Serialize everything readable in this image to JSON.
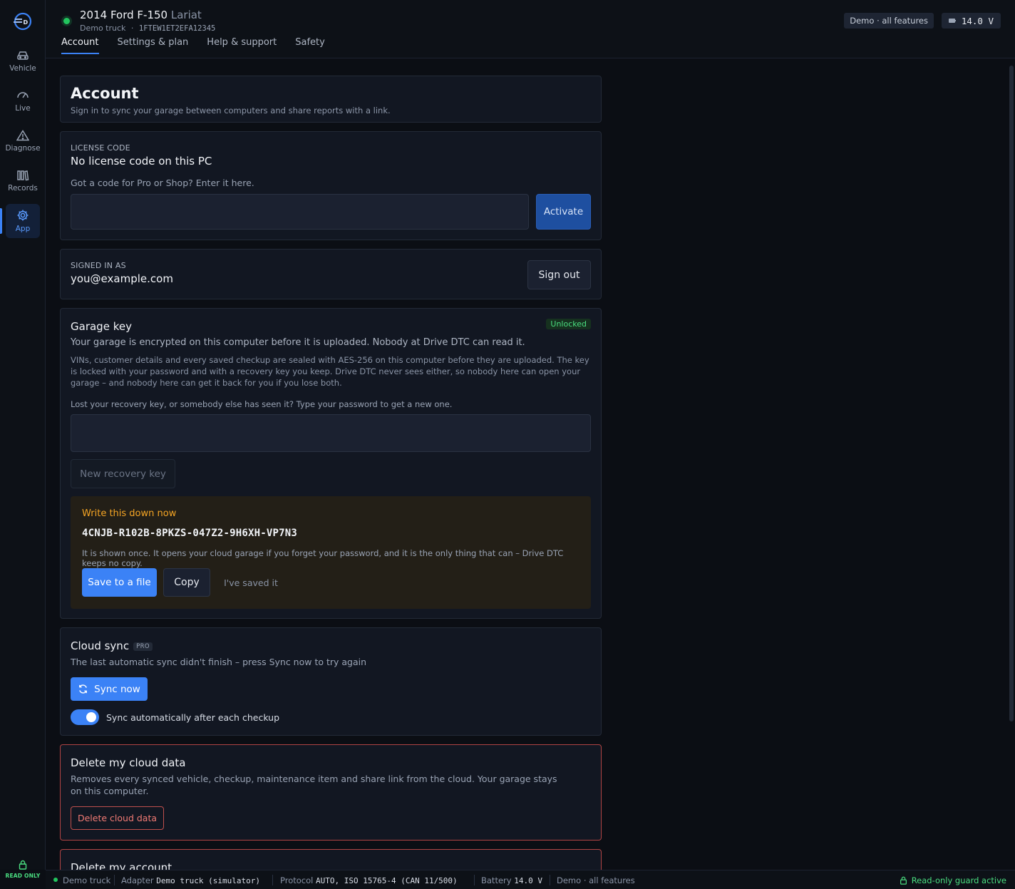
{
  "header": {
    "vehicle_title": "2014 Ford F-150",
    "vehicle_trim": "Lariat",
    "vehicle_label": "Demo truck",
    "separator": "·",
    "vin": "1FTEW1ET2EFA12345",
    "demo_badge": "Demo · all features",
    "voltage": "14.0 V",
    "tabs": [
      {
        "label": "Account",
        "active": true
      },
      {
        "label": "Settings & plan"
      },
      {
        "label": "Help & support"
      },
      {
        "label": "Safety"
      }
    ]
  },
  "sidebar": {
    "items": [
      {
        "label": "Vehicle",
        "icon": "car-icon"
      },
      {
        "label": "Live",
        "icon": "gauge-icon"
      },
      {
        "label": "Diagnose",
        "icon": "warning-icon"
      },
      {
        "label": "Records",
        "icon": "books-icon"
      },
      {
        "label": "App",
        "icon": "gear-icon",
        "active": true
      }
    ],
    "read_only_label": "READ ONLY"
  },
  "account": {
    "title": "Account",
    "subtitle": "Sign in to sync your garage between computers and share reports with a link."
  },
  "license": {
    "caption": "LICENSE CODE",
    "status": "No license code on this PC",
    "prompt": "Got a code for Pro or Shop? Enter it here.",
    "input_value": "",
    "activate_label": "Activate"
  },
  "signed_in": {
    "caption": "SIGNED IN AS",
    "email": "you@example.com",
    "sign_out_label": "Sign out"
  },
  "garage_key": {
    "title": "Garage key",
    "status_badge": "Unlocked",
    "summary": "Your garage is encrypted on this computer before it is uploaded. Nobody at Drive DTC can read it.",
    "details": "VINs, customer details and every saved checkup are sealed with AES-256 on this computer before they are uploaded. The key is locked with your password and with a recovery key you keep. Drive DTC never sees either, so nobody here can open your garage – and nobody here can get it back for you if you lose both.",
    "lost_prompt": "Lost your recovery key, or somebody else has seen it? Type your password to get a new one.",
    "password_value": "",
    "new_key_label": "New recovery key",
    "warning": {
      "title": "Write this down now",
      "recovery_key": "4CNJB-R102B-8PKZS-047Z2-9H6XH-VP7N3",
      "note": "It is shown once. It opens your cloud garage if you forget your password, and it is the only thing that can – Drive DTC keeps no copy.",
      "save_label": "Save to a file",
      "copy_label": "Copy",
      "saved_label": "I've saved it"
    }
  },
  "cloud_sync": {
    "title": "Cloud sync",
    "badge": "PRO",
    "status": "The last automatic sync didn't finish – press Sync now to try again",
    "sync_label": "Sync now",
    "auto_label": "Sync automatically after each checkup",
    "auto_enabled": true
  },
  "delete_cloud": {
    "title": "Delete my cloud data",
    "description": "Removes every synced vehicle, checkup, maintenance item and share link from the cloud. Your garage stays on this computer.",
    "button_label": "Delete cloud data"
  },
  "delete_account": {
    "title": "Delete my account"
  },
  "status_bar": {
    "vehicle": "Demo truck",
    "adapter_label": "Adapter",
    "adapter_value": "Demo truck (simulator)",
    "protocol_label": "Protocol",
    "protocol_value": "AUTO, ISO 15765-4 (CAN 11/500)",
    "battery_label": "Battery",
    "battery_value": "14.0 V",
    "mode": "Demo · all features",
    "guard": "Read-only guard active"
  },
  "colors": {
    "accent": "#3b82f6",
    "success": "#22c55e",
    "warning": "#f5a524",
    "danger": "#c0504d"
  }
}
